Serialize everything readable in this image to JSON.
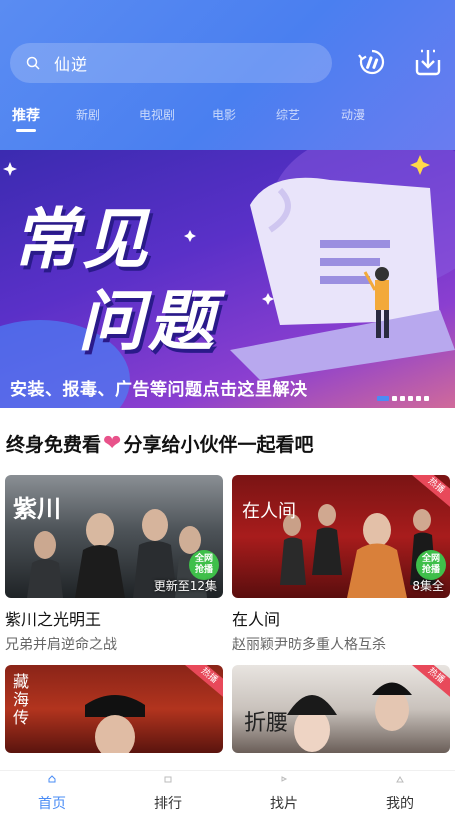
{
  "search": {
    "query": "仙逆"
  },
  "tabs": [
    {
      "label": "推荐"
    },
    {
      "label": "新剧"
    },
    {
      "label": "电视剧"
    },
    {
      "label": "电影"
    },
    {
      "label": "综艺"
    },
    {
      "label": "动漫"
    }
  ],
  "banner": {
    "title_line1": "常见",
    "title_line2": "问题",
    "caption": "安装、报毒、广告等问题点击这里解决",
    "slide_count": 6,
    "active_slide": 1
  },
  "section": {
    "title_left": "终身免费看",
    "title_right": "分享给小伙伴一起看吧",
    "heart_icon": "heart-icon"
  },
  "cards": [
    {
      "title": "紫川之光明王",
      "subtitle": "兄弟并肩逆命之战",
      "label": "更新至12集",
      "poster_text": "紫川",
      "badge": "全网\n抢播"
    },
    {
      "title": "在人间",
      "subtitle": "赵丽颖尹昉多重人格互杀",
      "label": "8集全",
      "poster_text": "在人间",
      "hot": "热播",
      "badge": "全网\n抢播"
    },
    {
      "poster_text": "藏海传",
      "hot": "热播"
    },
    {
      "poster_text": "折腰",
      "hot": "热播"
    }
  ],
  "nav": [
    {
      "label": "首页",
      "icon": "home-icon"
    },
    {
      "label": "排行",
      "icon": "rank-icon"
    },
    {
      "label": "找片",
      "icon": "find-icon"
    },
    {
      "label": "我的",
      "icon": "profile-icon"
    }
  ],
  "colors": {
    "accent": "#4a8cf5",
    "header": "#5a8cf2",
    "heart": "#e8528a",
    "hot": "#e8495a"
  }
}
